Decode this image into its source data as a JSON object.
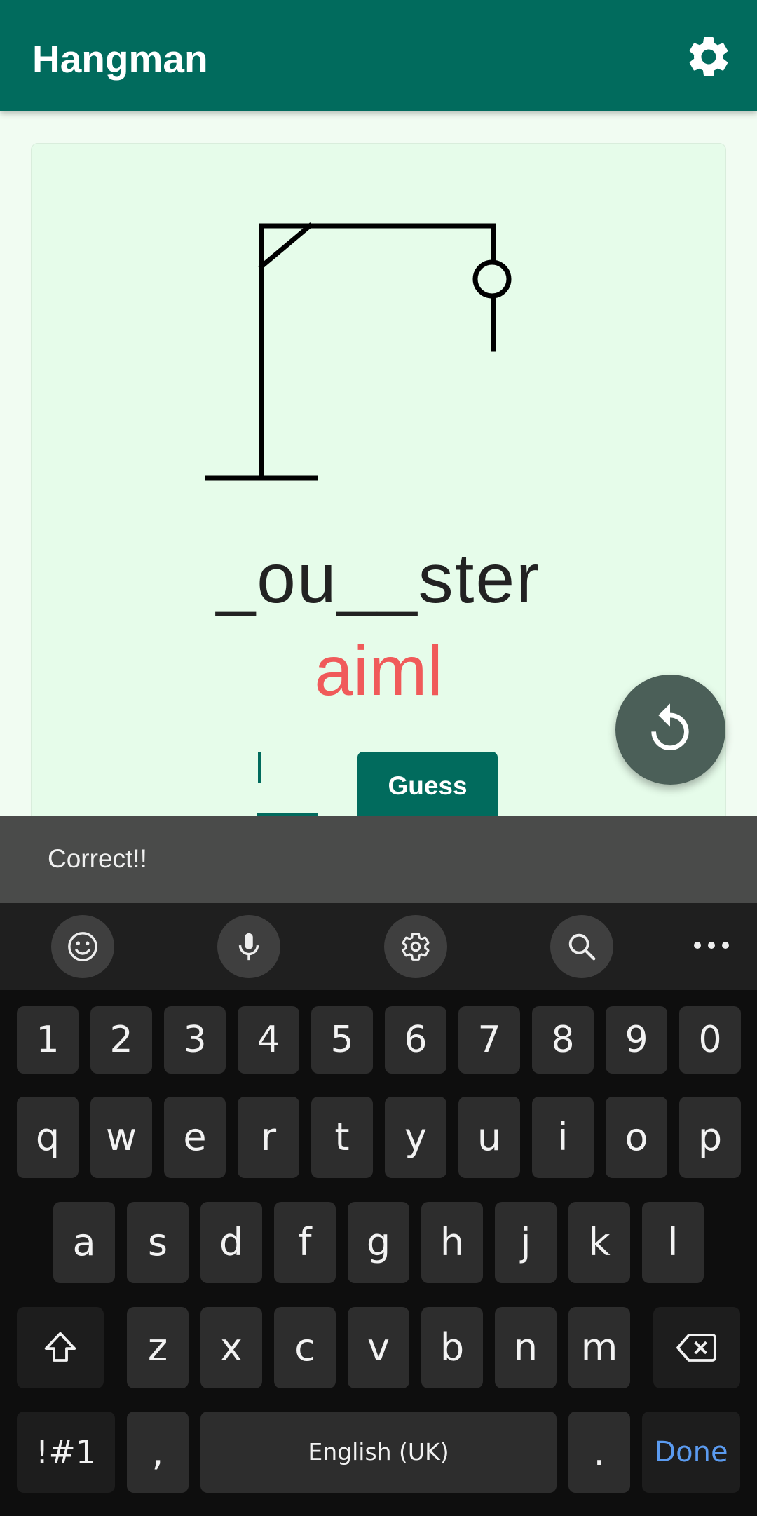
{
  "appbar": {
    "title": "Hangman",
    "settings_icon": "gear-icon"
  },
  "game": {
    "revealed_word": "_ou__ster",
    "wrong_letters": "aiml",
    "guess_value": "",
    "guess_button": "Guess",
    "restart_icon": "restart-icon",
    "colors": {
      "primary": "#016b5d",
      "wrong": "#f05a5a",
      "fab": "#4b5f58"
    }
  },
  "snackbar": {
    "message": "Correct!!"
  },
  "keyboard": {
    "toolbar": [
      "emoji-icon",
      "microphone-icon",
      "gear-icon",
      "search-icon",
      "more-icon"
    ],
    "numbers": [
      "1",
      "2",
      "3",
      "4",
      "5",
      "6",
      "7",
      "8",
      "9",
      "0"
    ],
    "row1": [
      "q",
      "w",
      "e",
      "r",
      "t",
      "y",
      "u",
      "i",
      "o",
      "p"
    ],
    "row2": [
      "a",
      "s",
      "d",
      "f",
      "g",
      "h",
      "j",
      "k",
      "l"
    ],
    "row3": [
      "z",
      "x",
      "c",
      "v",
      "b",
      "n",
      "m"
    ],
    "symbols_label": "!#1",
    "comma_label": ",",
    "space_label": "English (UK)",
    "period_label": ".",
    "done_label": "Done"
  }
}
